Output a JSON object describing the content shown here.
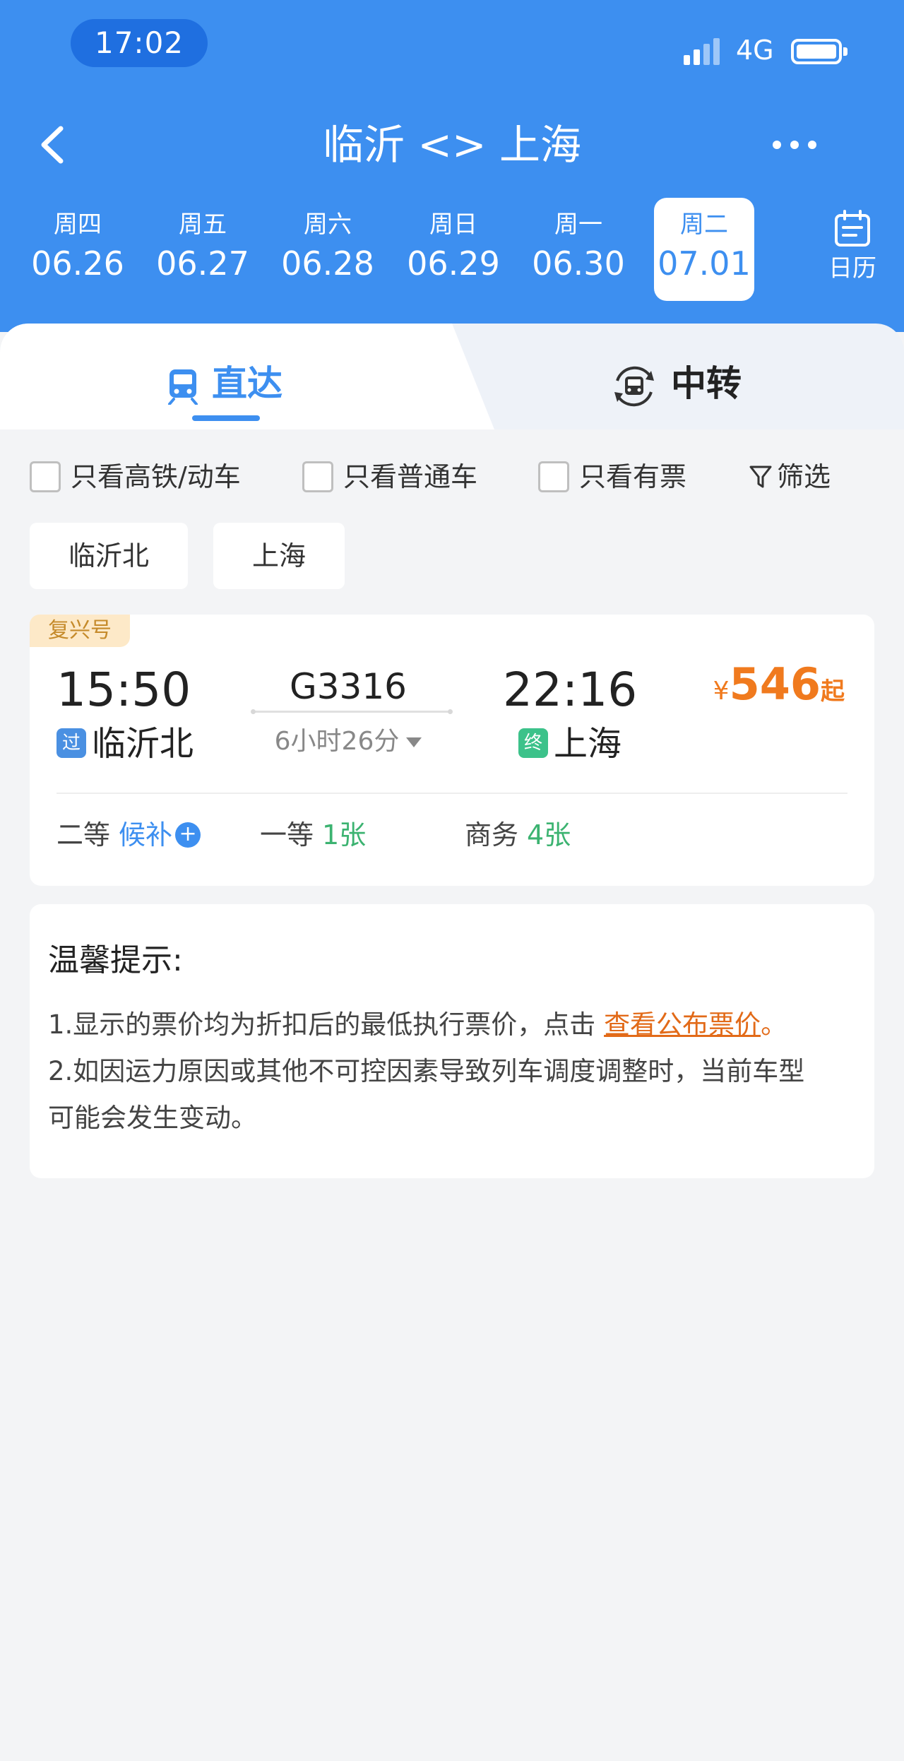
{
  "status_bar": {
    "time": "17:02",
    "network": "4G"
  },
  "nav": {
    "title": "临沂 <> 上海"
  },
  "dates": [
    {
      "weekday": "周四",
      "date": "06.26"
    },
    {
      "weekday": "周五",
      "date": "06.27"
    },
    {
      "weekday": "周六",
      "date": "06.28"
    },
    {
      "weekday": "周日",
      "date": "06.29"
    },
    {
      "weekday": "周一",
      "date": "06.30"
    },
    {
      "weekday": "周二",
      "date": "07.01",
      "selected": true
    }
  ],
  "calendar_label": "日历",
  "tabs": {
    "direct": "直达",
    "transfer": "中转"
  },
  "filters": {
    "gaotie": "只看高铁/动车",
    "putong": "只看普通车",
    "youpiao": "只看有票",
    "filter_btn": "筛选"
  },
  "station_chips": [
    "临沂北",
    "上海"
  ],
  "train": {
    "tag": "复兴号",
    "dep_time": "15:50",
    "train_no": "G3316",
    "arr_time": "22:16",
    "duration": "6小时26分",
    "dep_badge": "过",
    "dep_station": "临沂北",
    "arr_badge": "终",
    "arr_station": "上海",
    "price_currency": "¥",
    "price": "546",
    "price_suffix": "起",
    "seats": [
      {
        "class": "二等",
        "value": "候补"
      },
      {
        "class": "一等",
        "value": "1张"
      },
      {
        "class": "商务",
        "value": "4张"
      }
    ]
  },
  "tips": {
    "title": "温馨提示:",
    "line1": "1.显示的票价均为折扣后的最低执行票价，点击 ",
    "line1_link": "查看公布票价",
    "line1_end": "。",
    "line2": "2.如因运力原因或其他不可控因素导致列车调度调整时，当前车型",
    "line3": "可能会发生变动。"
  },
  "colors": {
    "primary": "#3d8ff0",
    "price": "#f07a1e",
    "green": "#3cb371"
  }
}
